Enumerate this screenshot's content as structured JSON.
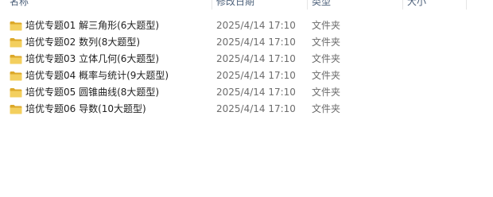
{
  "columns": {
    "name": "名称",
    "date": "修改日期",
    "type": "类型",
    "size": "大小"
  },
  "files": [
    {
      "name": "培优专题01 解三角形(6大题型)",
      "date": "2025/4/14 17:10",
      "type": "文件夹",
      "size": "",
      "icon": "folder-icon"
    },
    {
      "name": "培优专题02 数列(8大题型)",
      "date": "2025/4/14 17:10",
      "type": "文件夹",
      "size": "",
      "icon": "folder-icon"
    },
    {
      "name": "培优专题03 立体几何(6大题型)",
      "date": "2025/4/14 17:10",
      "type": "文件夹",
      "size": "",
      "icon": "folder-icon"
    },
    {
      "name": "培优专题04 概率与统计(9大题型)",
      "date": "2025/4/14 17:10",
      "type": "文件夹",
      "size": "",
      "icon": "folder-icon"
    },
    {
      "name": "培优专题05 圆锥曲线(8大题型)",
      "date": "2025/4/14 17:10",
      "type": "文件夹",
      "size": "",
      "icon": "folder-icon"
    },
    {
      "name": "培优专题06 导数(10大题型)",
      "date": "2025/4/14 17:10",
      "type": "文件夹",
      "size": "",
      "icon": "folder-icon"
    }
  ],
  "colors": {
    "folder_front": "#f3cf5e",
    "folder_back": "#dca829",
    "header_text": "#4c607a"
  }
}
